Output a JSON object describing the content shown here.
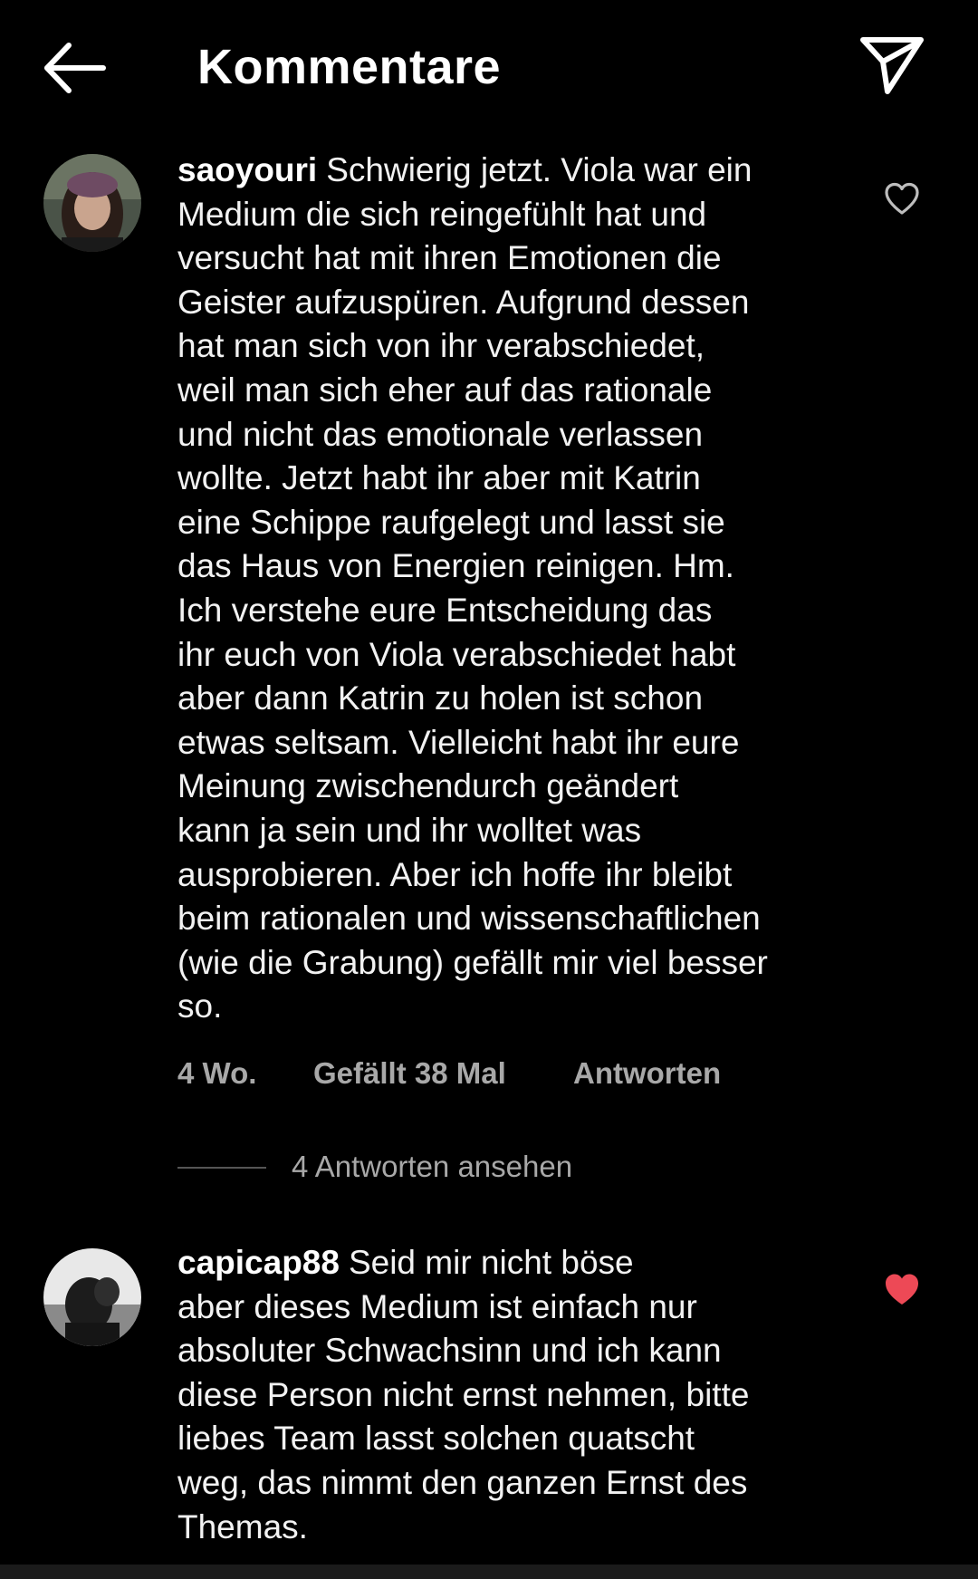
{
  "header": {
    "title": "Kommentare",
    "back_icon": "arrow-left-icon",
    "share_icon": "paper-plane-icon"
  },
  "comments": [
    {
      "username": "saoyouri",
      "text": "Schwierig jetzt. Viola war ein\nMedium die sich reingefühlt hat und\nversucht hat mit ihren Emotionen die\nGeister aufzuspüren. Aufgrund dessen\nhat man sich von ihr verabschiedet,\nweil man sich eher auf das rationale\nund nicht das emotionale verlassen\nwollte. Jetzt habt ihr aber mit Katrin\neine Schippe raufgelegt und lasst sie\ndas Haus von Energien reinigen. Hm.\nIch verstehe eure Entscheidung das\nihr euch von Viola verabschiedet habt\naber dann Katrin zu holen ist schon\netwas seltsam. Vielleicht habt ihr eure\nMeinung zwischendurch geändert\nkann ja sein und ihr wolltet was\nausprobieren. Aber ich hoffe ihr bleibt\nbeim rationalen und wissenschaftlichen\n(wie die Grabung) gefällt mir viel besser\nso.",
      "time": "4 Wo.",
      "likes": "Gefällt 38 Mal",
      "reply": "Antworten",
      "view_replies": "4 Antworten ansehen",
      "liked": false
    },
    {
      "username": "capicap88",
      "text": "Seid mir nicht böse\naber dieses Medium ist einfach nur\nabsoluter Schwachsinn und ich kann\ndiese Person nicht ernst nehmen, bitte\nliebes Team lasst solchen quatscht\nweg, das nimmt den ganzen Ernst des\nThemas.",
      "liked": true
    }
  ],
  "colors": {
    "background": "#000000",
    "text": "#f2f2f2",
    "meta": "#a8a8a8",
    "like_active": "#ed4956"
  }
}
